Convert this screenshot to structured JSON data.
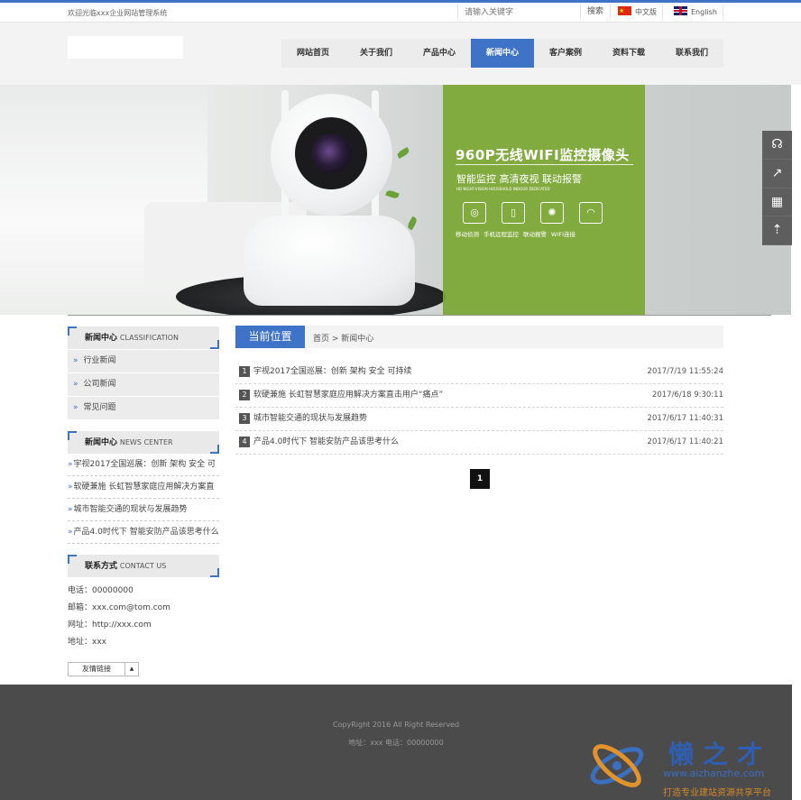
{
  "topbar": {
    "welcome": "欢迎光临xxx企业网站管理系统",
    "search_placeholder": "请输入关键字",
    "search_button": "搜索",
    "lang_cn": "中文版",
    "lang_en": "English"
  },
  "colors": {
    "accent": "#3f73c7",
    "footer": "#4b4b4b",
    "banner_green": "#7ca834"
  },
  "nav": {
    "items": [
      "网站首页",
      "关于我们",
      "产品中心",
      "新闻中心",
      "客户案例",
      "资料下载",
      "联系我们"
    ],
    "active": "新闻中心"
  },
  "banner": {
    "title": "960P无线WIFI监控摄像头",
    "subtitle": "智能监控 高清夜视 联动报警",
    "tiny": "HD NIGHT-VISION HOUSEHOLD INDOOR DEDICATED",
    "features": [
      {
        "icon": "motion-detect-icon",
        "label": "移动侦测"
      },
      {
        "icon": "phone-monitor-icon",
        "label": "手机远程监控"
      },
      {
        "icon": "alarm-icon",
        "label": "联动报警"
      },
      {
        "icon": "wifi-icon",
        "label": "WIFI连接"
      }
    ]
  },
  "float_bar": [
    "headset-icon",
    "share-icon",
    "qrcode-icon",
    "rocket-icon"
  ],
  "sidebar": {
    "classification": {
      "title": "新闻中心",
      "en": "CLASSIFICATION",
      "items": [
        "行业新闻",
        "公司新闻",
        "常见问题"
      ]
    },
    "news": {
      "title": "新闻中心",
      "en": "NEWS CENTER",
      "items": [
        "宇视2017全国巡展：创新 架构 安全 可",
        "软硬兼施 长虹智慧家庭应用解决方案直",
        "城市智能交通的现状与发展趋势",
        "产品4.0时代下 智能安防产品该思考什么"
      ]
    },
    "contact": {
      "title": "联系方式",
      "en": "CONTACT US",
      "lines": [
        "电话：00000000",
        "邮箱：xxx.com@tom.com",
        "网址：http://xxx.com",
        "地址：xxx"
      ]
    },
    "links_label": "友情链接"
  },
  "main": {
    "crumb_title": "当前位置",
    "crumb_path": "首页 > 新闻中心",
    "articles": [
      {
        "num": "1",
        "title": "宇视2017全国巡展：创新 架构 安全 可持续",
        "date": "2017/7/19 11:55:24"
      },
      {
        "num": "2",
        "title": "软硬兼施 长虹智慧家庭应用解决方案直击用户“痛点”",
        "date": "2017/6/18 9:30:11"
      },
      {
        "num": "3",
        "title": "城市智能交通的现状与发展趋势",
        "date": "2017/6/17 11:40:31"
      },
      {
        "num": "4",
        "title": "产品4.0时代下 智能安防产品该思考什么",
        "date": "2017/6/17 11:40:21"
      }
    ],
    "page": "1"
  },
  "footer": {
    "copyright": "CopyRight 2016 All Right Reserved",
    "address": "地址：xxx  电话：00000000"
  },
  "watermark": {
    "text": "懒之才",
    "url": "www.aizhanzhe.com",
    "slogan": "打造专业建站资源共享平台"
  }
}
